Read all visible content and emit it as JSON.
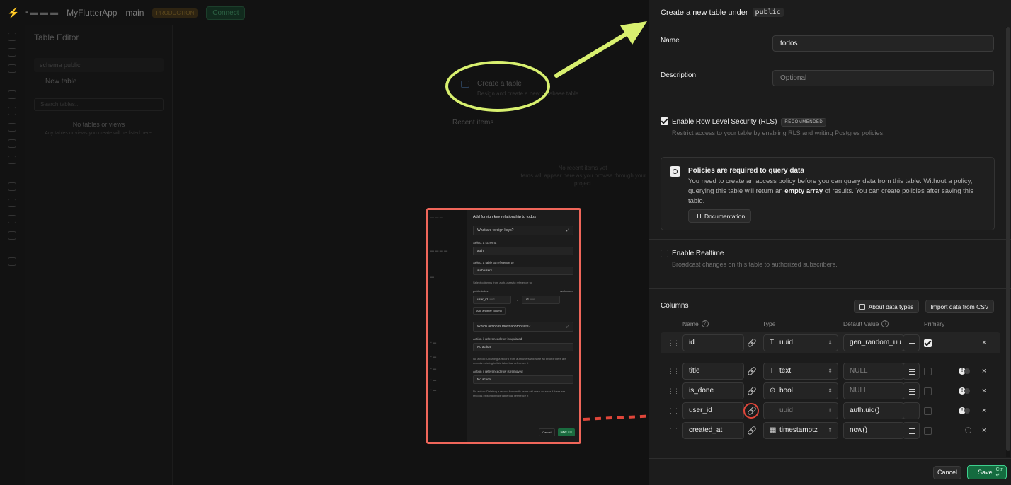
{
  "background": {
    "project": "MyFlutterApp",
    "branch": "main",
    "env_badge": "PRODUCTION",
    "connect_label": "Connect",
    "sidebar_title": "Table Editor",
    "schema_prefix": "schema",
    "schema_name": "public",
    "new_table": "New table",
    "search_placeholder": "Search tables...",
    "no_tables": "No tables or views",
    "no_tables_sub": "Any tables or views you create will be listed here.",
    "create_table_title": "Create a table",
    "create_table_sub": "Design and create a new database table",
    "recent_items": "Recent items",
    "no_recent": "No recent items yet",
    "no_recent_sub": "Items will appear here as you browse through your project"
  },
  "fk_screenshot": {
    "title": "Add foreign key relationship to todos",
    "faq1": "What are foreign keys?",
    "schema_label": "Select a schema",
    "schema_value": "auth",
    "table_label": "Select a table to reference to",
    "table_schema": "auth",
    "table_value": "users",
    "columns_hint": "Select columns from auth.users to reference to",
    "left_head": "public.todos",
    "right_head": "auth.users",
    "left_col": "user_id",
    "left_type": "uuid",
    "right_col": "id",
    "right_type": "uuid",
    "add_column": "Add another column",
    "faq2": "Which action is most appropriate?",
    "update_label": "Action if referenced row is updated",
    "update_value": "No action",
    "update_desc": "No action: Updating a record from auth.users will raise an error if there are records existing in this table that reference it",
    "remove_label": "Action if referenced row is removed",
    "remove_value": "No action",
    "remove_desc": "No action: Deleting a record from auth.users will raise an error if there are records existing in this table that reference it",
    "cancel": "Cancel",
    "save": "Save",
    "save_kbd": "Ctrl"
  },
  "panel": {
    "title": "Create a new table under",
    "schema": "public",
    "name_label": "Name",
    "name_value": "todos",
    "description_label": "Description",
    "description_placeholder": "Optional",
    "rls_title": "Enable Row Level Security (RLS)",
    "rls_badge": "RECOMMENDED",
    "rls_desc": "Restrict access to your table by enabling RLS and writing Postgres policies.",
    "policy_title": "Policies are required to query data",
    "policy_body_1": "You need to create an access policy before you can query data from this table. Without a policy, querying this table will return an",
    "policy_body_link": "empty array",
    "policy_body_2": "of results. You can create policies after saving this table.",
    "docs_button": "Documentation",
    "realtime_title": "Enable Realtime",
    "realtime_desc": "Broadcast changes on this table to authorized subscribers.",
    "columns_title": "Columns",
    "about_types": "About data types",
    "import_csv": "Import data from CSV",
    "head_name": "Name",
    "head_type": "Type",
    "head_default": "Default Value",
    "head_primary": "Primary",
    "rows": [
      {
        "name": "id",
        "type_glyph": "T",
        "type": "uuid",
        "default": "gen_random_uu",
        "default_muted": false,
        "type_muted": false,
        "primary": true
      },
      {
        "name": "title",
        "type_glyph": "T",
        "type": "text",
        "default": "NULL",
        "default_muted": true,
        "type_muted": false,
        "primary": false
      },
      {
        "name": "is_done",
        "type_glyph": "⊙",
        "type": "bool",
        "default": "NULL",
        "default_muted": true,
        "type_muted": false,
        "primary": false
      },
      {
        "name": "user_id",
        "type_glyph": "",
        "type": "uuid",
        "default": "auth.uid()",
        "default_muted": false,
        "type_muted": true,
        "primary": false
      },
      {
        "name": "created_at",
        "type_glyph": "▦",
        "type": "timestamptz",
        "default": "now()",
        "default_muted": false,
        "type_muted": false,
        "primary": false
      }
    ],
    "cancel": "Cancel",
    "save": "Save",
    "save_kbd": "Ctrl ↵"
  }
}
